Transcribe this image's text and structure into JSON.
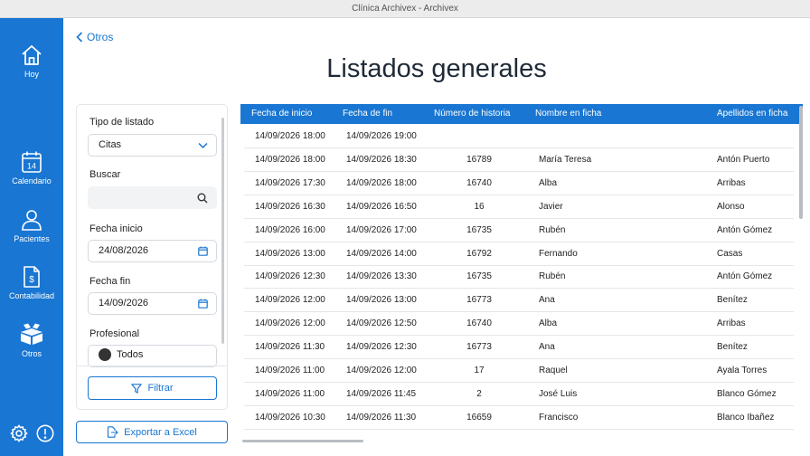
{
  "window": {
    "title": "Clínica Archivex - Archivex"
  },
  "sidebar": {
    "items": [
      {
        "label": "Hoy",
        "icon": "home-icon"
      },
      {
        "label": "Calendario",
        "icon": "calendar-icon",
        "badge": "14"
      },
      {
        "label": "Pacientes",
        "icon": "person-icon"
      },
      {
        "label": "Contabilidad",
        "icon": "invoice-icon"
      },
      {
        "label": "Otros",
        "icon": "boxes-icon"
      }
    ],
    "bottom_icons": [
      "gear-icon",
      "info-icon"
    ]
  },
  "colors": {
    "accent": "#1976d2",
    "sidebar_bg": "#1976d2"
  },
  "header": {
    "back_label": "Otros",
    "title": "Listados generales"
  },
  "filters": {
    "tipo_label": "Tipo de listado",
    "tipo_value": "Citas",
    "buscar_label": "Buscar",
    "buscar_value": "",
    "fecha_inicio_label": "Fecha inicio",
    "fecha_inicio_value": "24/08/2026",
    "fecha_fin_label": "Fecha fin",
    "fecha_fin_value": "14/09/2026",
    "profesional_label": "Profesional",
    "profesional_value": "Todos",
    "filter_button": "Filtrar"
  },
  "export_button": "Exportar a Excel",
  "table": {
    "columns": [
      "Fecha de inicio",
      "Fecha de fin",
      "Número de historia",
      "Nombre en ficha",
      "Apellidos en ficha"
    ],
    "rows": [
      [
        "14/09/2026 18:00",
        "14/09/2026 19:00",
        "",
        "",
        ""
      ],
      [
        "14/09/2026 18:00",
        "14/09/2026 18:30",
        "16789",
        "María Teresa",
        "Antón Puerto"
      ],
      [
        "14/09/2026 17:30",
        "14/09/2026 18:00",
        "16740",
        "Alba",
        "Arribas"
      ],
      [
        "14/09/2026 16:30",
        "14/09/2026 16:50",
        "16",
        "Javier",
        "Alonso"
      ],
      [
        "14/09/2026 16:00",
        "14/09/2026 17:00",
        "16735",
        "Rubén",
        "Antón Gómez"
      ],
      [
        "14/09/2026 13:00",
        "14/09/2026 14:00",
        "16792",
        "Fernando",
        "Casas"
      ],
      [
        "14/09/2026 12:30",
        "14/09/2026 13:30",
        "16735",
        "Rubén",
        "Antón Gómez"
      ],
      [
        "14/09/2026 12:00",
        "14/09/2026 13:00",
        "16773",
        "Ana",
        "Benítez"
      ],
      [
        "14/09/2026 12:00",
        "14/09/2026 12:50",
        "16740",
        "Alba",
        "Arribas"
      ],
      [
        "14/09/2026 11:30",
        "14/09/2026 12:30",
        "16773",
        "Ana",
        "Benítez"
      ],
      [
        "14/09/2026 11:00",
        "14/09/2026 12:00",
        "17",
        "Raquel",
        "Ayala Torres"
      ],
      [
        "14/09/2026 11:00",
        "14/09/2026 11:45",
        "2",
        "José Luis",
        "Blanco Gómez"
      ],
      [
        "14/09/2026 10:30",
        "14/09/2026 11:30",
        "16659",
        "Francisco",
        "Blanco Ibañez"
      ]
    ]
  }
}
